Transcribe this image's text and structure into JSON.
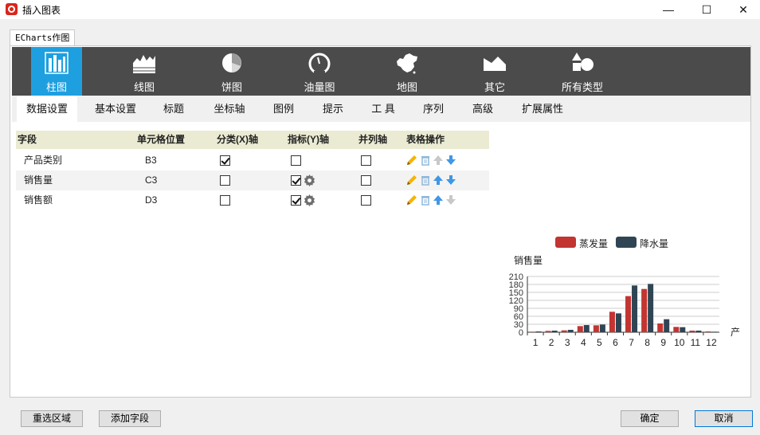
{
  "window": {
    "title": "插入图表",
    "controls": {
      "minimize": "—",
      "maximize": "☐",
      "close": "✕"
    }
  },
  "outer_tab": "ECharts作图",
  "chart_types": [
    {
      "label": "柱图",
      "icon": "bar-chart-icon",
      "active": true
    },
    {
      "label": "线图",
      "icon": "area-line-chart-icon",
      "active": false
    },
    {
      "label": "饼图",
      "icon": "pie-chart-icon",
      "active": false
    },
    {
      "label": "油量图",
      "icon": "gauge-icon",
      "active": false
    },
    {
      "label": "地图",
      "icon": "china-map-icon",
      "active": false
    },
    {
      "label": "其它",
      "icon": "mountain-chart-icon",
      "active": false
    },
    {
      "label": "所有类型",
      "icon": "shapes-icon",
      "active": false
    }
  ],
  "settings_tabs": [
    "数据设置",
    "基本设置",
    "标题",
    "坐标轴",
    "图例",
    "提示",
    "工 具",
    "序列",
    "高级",
    "扩展属性"
  ],
  "field_table": {
    "headers": [
      "字段",
      "单元格位置",
      "分类(X)轴",
      "指标(Y)轴",
      "并列轴",
      "表格操作"
    ],
    "rows": [
      {
        "field": "产品类别",
        "cell": "B3",
        "x_axis": true,
        "y_axis": false,
        "parallel": false,
        "has_gear": false,
        "up_enabled": false,
        "down_enabled": true
      },
      {
        "field": "销售量",
        "cell": "C3",
        "x_axis": false,
        "y_axis": true,
        "parallel": false,
        "has_gear": true,
        "up_enabled": true,
        "down_enabled": true
      },
      {
        "field": "销售额",
        "cell": "D3",
        "x_axis": false,
        "y_axis": true,
        "parallel": false,
        "has_gear": true,
        "up_enabled": true,
        "down_enabled": false
      }
    ]
  },
  "chart_data": {
    "type": "bar",
    "ylabel": "销售量",
    "xlabel": "产",
    "categories": [
      "1",
      "2",
      "3",
      "4",
      "5",
      "6",
      "7",
      "8",
      "9",
      "10",
      "11",
      "12"
    ],
    "series": [
      {
        "name": "蒸发量",
        "color": "#c23531",
        "values": [
          2,
          5,
          7,
          23,
          26,
          77,
          136,
          163,
          33,
          20,
          6,
          3
        ]
      },
      {
        "name": "降水量",
        "color": "#2f4554",
        "values": [
          3,
          6,
          9,
          27,
          29,
          71,
          176,
          182,
          49,
          19,
          6,
          2
        ]
      }
    ],
    "ylim": [
      0,
      210
    ],
    "yticks": [
      0,
      30,
      60,
      90,
      120,
      150,
      180,
      210
    ],
    "grid": true,
    "legend": "top-center"
  },
  "buttons": {
    "reselect": "重选区域",
    "add_field": "添加字段",
    "ok": "确定",
    "cancel": "取消"
  }
}
